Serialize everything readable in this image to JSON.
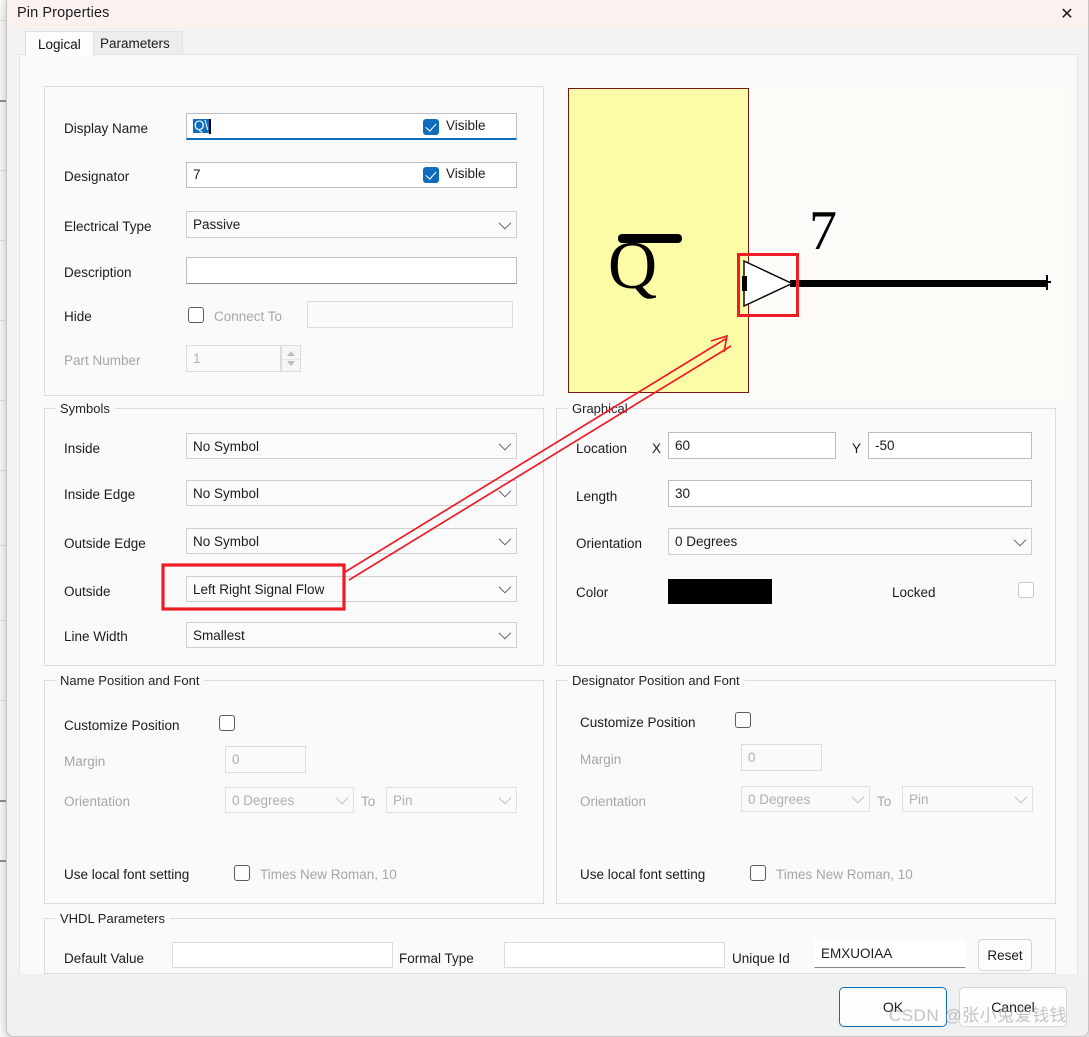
{
  "window": {
    "title": "Pin Properties",
    "close_label": "✕"
  },
  "tabs": [
    {
      "label": "Logical",
      "active": true
    },
    {
      "label": "Parameters",
      "active": false
    }
  ],
  "logical": {
    "display_name": {
      "label": "Display Name",
      "value": "Q\\",
      "visible_label": "Visible",
      "visible_checked": true
    },
    "designator": {
      "label": "Designator",
      "value": "7",
      "visible_label": "Visible",
      "visible_checked": true
    },
    "electrical_type": {
      "label": "Electrical Type",
      "value": "Passive"
    },
    "description": {
      "label": "Description",
      "value": ""
    },
    "hide": {
      "label": "Hide",
      "checked": false,
      "connect_to_label": "Connect To",
      "connect_to_value": ""
    },
    "part_number": {
      "label": "Part Number",
      "value": "1"
    }
  },
  "symbols": {
    "legend": "Symbols",
    "inside": {
      "label": "Inside",
      "value": "No Symbol"
    },
    "inside_edge": {
      "label": "Inside Edge",
      "value": "No Symbol"
    },
    "outside_edge": {
      "label": "Outside Edge",
      "value": "No Symbol"
    },
    "outside": {
      "label": "Outside",
      "value": "Left Right Signal Flow"
    },
    "line_width": {
      "label": "Line Width",
      "value": "Smallest"
    }
  },
  "graphical": {
    "legend": "Graphical",
    "location_label": "Location",
    "x_label": "X",
    "x_value": "60",
    "y_label": "Y",
    "y_value": "-50",
    "length_label": "Length",
    "length_value": "30",
    "orientation_label": "Orientation",
    "orientation_value": "0 Degrees",
    "color_label": "Color",
    "color_value": "#000000",
    "locked_label": "Locked",
    "locked_checked": false
  },
  "name_position": {
    "legend": "Name Position and Font",
    "customize_label": "Customize Position",
    "customize_checked": false,
    "margin_label": "Margin",
    "margin_value": "0",
    "orientation_label": "Orientation",
    "orientation_value": "0 Degrees",
    "to_label": "To",
    "to_value": "Pin",
    "use_local_font_label": "Use local font setting",
    "use_local_font_checked": false,
    "font_value": "Times New Roman, 10"
  },
  "designator_position": {
    "legend": "Designator Position and Font",
    "customize_label": "Customize Position",
    "customize_checked": false,
    "margin_label": "Margin",
    "margin_value": "0",
    "orientation_label": "Orientation",
    "orientation_value": "0 Degrees",
    "to_label": "To",
    "to_value": "Pin",
    "use_local_font_label": "Use local font setting",
    "use_local_font_checked": false,
    "font_value": "Times New Roman, 10"
  },
  "vhdl": {
    "legend": "VHDL Parameters",
    "default_value_label": "Default Value",
    "default_value": "",
    "formal_type_label": "Formal Type",
    "formal_type_value": "",
    "unique_id_label": "Unique Id",
    "unique_id_value": "EMXUOIAA",
    "reset_label": "Reset"
  },
  "preview": {
    "pin_name": "Q",
    "designator": "7",
    "body_color": "#FCFCA8",
    "body_border_color": "#7C1414",
    "highlight_color": "#EE1C25"
  },
  "footer": {
    "ok_label": "OK",
    "cancel_label": "Cancel"
  },
  "watermark": {
    "text": "CSDN @张小兔爱钱钱"
  }
}
